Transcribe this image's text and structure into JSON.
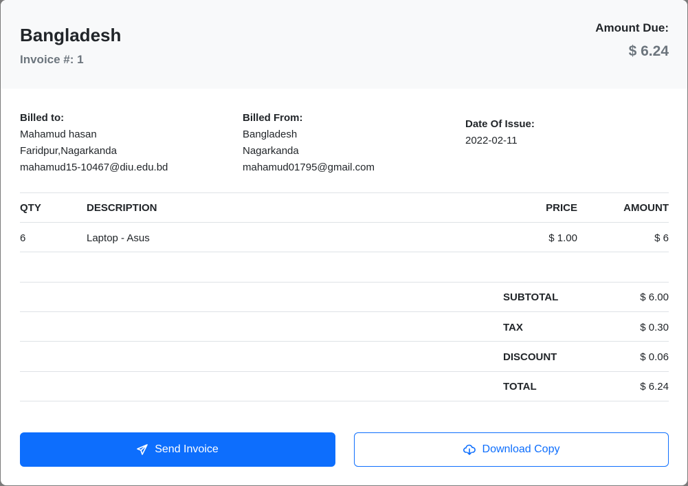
{
  "header": {
    "title": "Bangladesh",
    "invoice_number": "Invoice #: 1",
    "amount_due_label": "Amount Due:",
    "amount_due_value": "$ 6.24"
  },
  "billed_to": {
    "label": "Billed to:",
    "name": "Mahamud hasan",
    "address": "Faridpur,Nagarkanda",
    "email": "mahamud15-10467@diu.edu.bd"
  },
  "billed_from": {
    "label": "Billed From:",
    "name": "Bangladesh",
    "address": "Nagarkanda",
    "email": "mahamud01795@gmail.com"
  },
  "issue": {
    "label": "Date Of Issue:",
    "date": "2022-02-11"
  },
  "table": {
    "headers": {
      "qty": "QTY",
      "description": "DESCRIPTION",
      "price": "PRICE",
      "amount": "AMOUNT"
    },
    "rows": [
      {
        "qty": "6",
        "description": "Laptop - Asus",
        "price": "$ 1.00",
        "amount": "$ 6"
      }
    ]
  },
  "totals": [
    {
      "label": "SUBTOTAL",
      "value": "$ 6.00"
    },
    {
      "label": "TAX",
      "value": "$ 0.30"
    },
    {
      "label": "DISCOUNT",
      "value": "$ 0.06"
    },
    {
      "label": "TOTAL",
      "value": "$ 6.24"
    }
  ],
  "buttons": {
    "send": "Send Invoice",
    "download": "Download Copy"
  },
  "colors": {
    "primary": "#0d6efd",
    "header_bg": "#f8f9fa",
    "muted": "#6c757d"
  }
}
